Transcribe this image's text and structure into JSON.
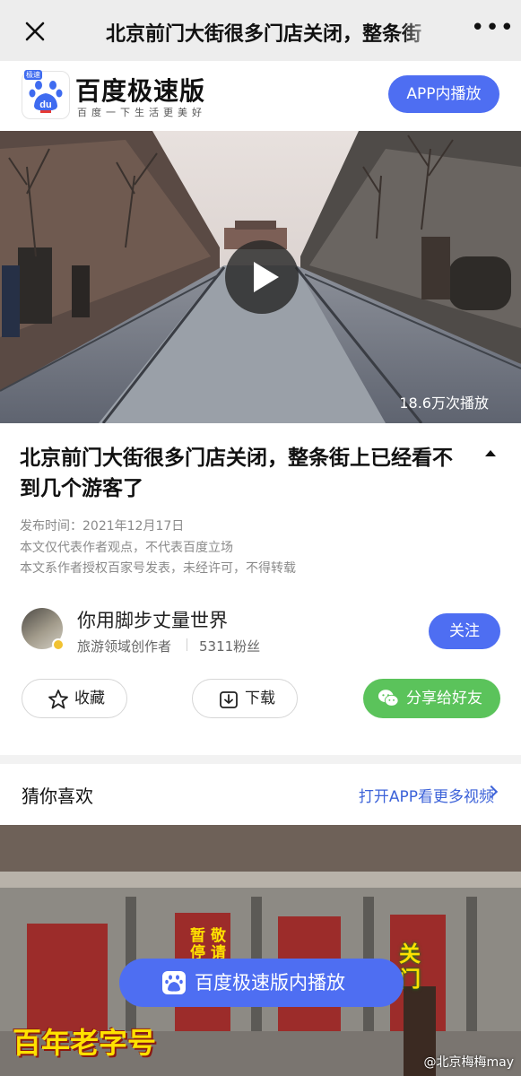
{
  "top_bar": {
    "title": "北京前门大街很多门店关闭，整条街",
    "close_icon": "close-icon",
    "more_icon": "more-icon",
    "more_glyph": "•••"
  },
  "brand": {
    "name": "百度极速版",
    "slogan": "百度一下生活更美好",
    "logo_badge": "极速",
    "logo_text": "du",
    "app_play_label": "APP内播放"
  },
  "video": {
    "views": "18.6万次播放",
    "play_icon": "play-icon"
  },
  "article": {
    "title": "北京前门大街很多门店关闭，整条街上已经看不到几个游客了",
    "publish_time": "发布时间：2021年12月17日",
    "disclaimer_1": "本文仅代表作者观点，不代表百度立场",
    "disclaimer_2": "本文系作者授权百家号发表，未经许可，不得转载"
  },
  "author": {
    "name": "你用脚步丈量世界",
    "role": "旅游领域创作者",
    "fans": "5311粉丝",
    "follow_label": "关注"
  },
  "actions": {
    "collect_label": "收藏",
    "download_label": "下载",
    "share_label": "分享给好友"
  },
  "recommend": {
    "title": "猜你喜欢",
    "more_label": "打开APP看更多视频"
  },
  "rec_video": {
    "sign_1": "暂停开店",
    "sign_2": "敬请期待",
    "overlay_right": "关门",
    "overlay_bottom": "百年老字号",
    "float_play_label": "百度极速版内播放",
    "watermark": "@北京梅梅may"
  },
  "colors": {
    "accent_blue": "#4e6ef2",
    "link_blue": "#3d63d9",
    "share_green": "#5bc35b",
    "overlay_yellow": "#ffe100"
  }
}
